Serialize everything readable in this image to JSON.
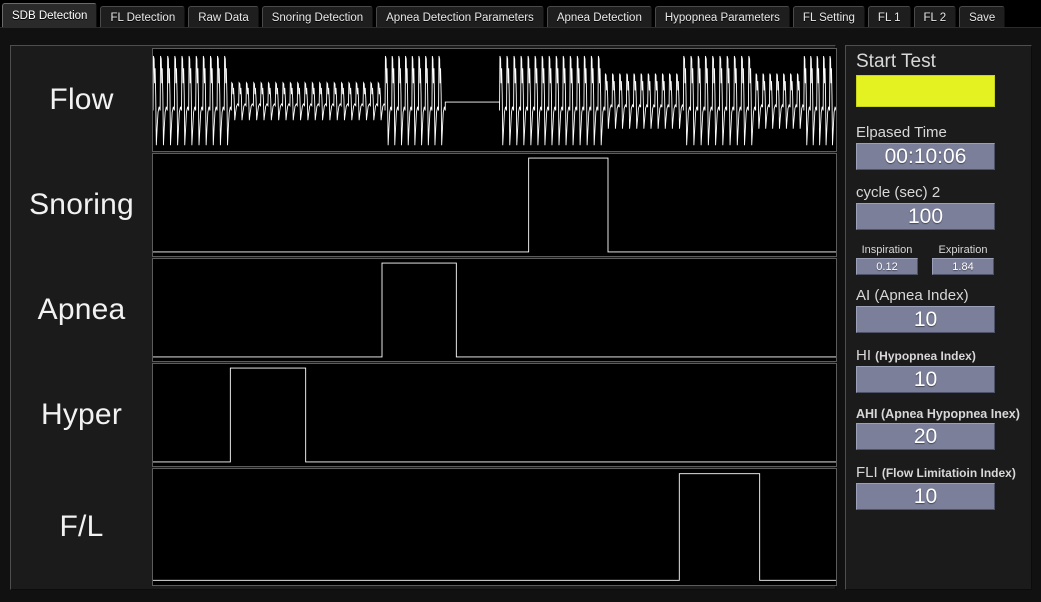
{
  "window": {
    "title": "SDB Detection"
  },
  "tabs": [
    {
      "label": "SDB Detection",
      "active": true
    },
    {
      "label": "FL Detection",
      "active": false
    },
    {
      "label": "Raw Data",
      "active": false
    },
    {
      "label": "Snoring Detection",
      "active": false
    },
    {
      "label": "Apnea Detection Parameters",
      "active": false
    },
    {
      "label": "Apnea Detection",
      "active": false
    },
    {
      "label": "Hypopnea  Parameters",
      "active": false
    },
    {
      "label": "FL Setting",
      "active": false
    },
    {
      "label": "FL 1",
      "active": false
    },
    {
      "label": "FL 2",
      "active": false
    },
    {
      "label": "Save",
      "active": false
    }
  ],
  "channels": [
    {
      "label": "Flow"
    },
    {
      "label": "Snoring"
    },
    {
      "label": "Apnea"
    },
    {
      "label": "Hyper"
    },
    {
      "label": "F/L"
    }
  ],
  "sidebar": {
    "start_test_label": "Start Test",
    "start_button_color": "#e4f221",
    "elapsed_time_label": "Elpased Time",
    "elapsed_time_value": "00:10:06",
    "cycle_label": "cycle (sec) 2",
    "cycle_value": "100",
    "inspiration_label": "Inspiration",
    "inspiration_value": "0.12",
    "expiration_label": "Expiration",
    "expiration_value": "1.84",
    "ai_label_main": "AI (Apnea Index)",
    "ai_value": "10",
    "hi_label_prefix": "HI ",
    "hi_label_paren": "(Hypopnea Index)",
    "hi_value": "10",
    "ahi_label": "AHI (Apnea Hypopnea Inex)",
    "ahi_value": "20",
    "fli_label_prefix": "FLI ",
    "fli_label_paren": "(Flow Limitatioin Index)",
    "fli_value": "10"
  },
  "chart_data": [
    {
      "type": "line",
      "title": "Flow",
      "xlabel": "",
      "ylabel": "",
      "xlim": [
        0,
        680
      ],
      "ylim": [
        -1,
        1
      ],
      "grid": false,
      "trace_color": "#ffffff",
      "description": "Respiratory airflow waveform: repeating breath cycles with sharp inspiratory peaks and expiratory troughs. Amplitude varies by segment; one flat (zero-flow) apnea segment.",
      "segments": [
        {
          "start": 0,
          "end": 78,
          "amplitude": 1.0,
          "breaths": 11,
          "state": "normal"
        },
        {
          "start": 78,
          "end": 231,
          "amplitude": 0.42,
          "breaths": 21,
          "state": "hypopnea"
        },
        {
          "start": 231,
          "end": 291,
          "amplitude": 1.0,
          "breaths": 9,
          "state": "normal"
        },
        {
          "start": 291,
          "end": 345,
          "amplitude": 0.0,
          "breaths": 0,
          "state": "apnea-flat"
        },
        {
          "start": 345,
          "end": 450,
          "amplitude": 1.0,
          "breaths": 15,
          "state": "normal"
        },
        {
          "start": 450,
          "end": 528,
          "amplitude": 0.62,
          "breaths": 11,
          "state": "reduced"
        },
        {
          "start": 528,
          "end": 600,
          "amplitude": 1.0,
          "breaths": 10,
          "state": "normal"
        },
        {
          "start": 600,
          "end": 648,
          "amplitude": 0.62,
          "breaths": 7,
          "state": "reduced"
        },
        {
          "start": 648,
          "end": 680,
          "amplitude": 1.0,
          "breaths": 5,
          "state": "normal"
        }
      ]
    },
    {
      "type": "line",
      "title": "Snoring",
      "xlim": [
        0,
        680
      ],
      "ylim": [
        0,
        1
      ],
      "grid": false,
      "trace_color": "#ffffff",
      "description": "Binary snoring event detector; single rectangular HIGH pulse.",
      "pulses": [
        {
          "start": 374,
          "end": 453,
          "level": 1
        }
      ],
      "baseline": 0
    },
    {
      "type": "line",
      "title": "Apnea",
      "xlim": [
        0,
        680
      ],
      "ylim": [
        0,
        1
      ],
      "grid": false,
      "trace_color": "#ffffff",
      "description": "Binary apnea event detector; single rectangular HIGH pulse.",
      "pulses": [
        {
          "start": 228,
          "end": 302,
          "level": 1
        }
      ],
      "baseline": 0
    },
    {
      "type": "line",
      "title": "Hyper",
      "xlim": [
        0,
        680
      ],
      "ylim": [
        0,
        1
      ],
      "grid": false,
      "trace_color": "#ffffff",
      "description": "Binary hypopnea event detector; single rectangular HIGH pulse near start.",
      "pulses": [
        {
          "start": 77,
          "end": 152,
          "level": 1
        }
      ],
      "baseline": 0
    },
    {
      "type": "line",
      "title": "F/L",
      "xlim": [
        0,
        680
      ],
      "ylim": [
        0,
        1
      ],
      "grid": false,
      "trace_color": "#ffffff",
      "description": "Binary flow-limitation event detector; single rectangular HIGH pulse near end.",
      "pulses": [
        {
          "start": 524,
          "end": 604,
          "level": 1
        }
      ],
      "baseline": 0
    }
  ]
}
